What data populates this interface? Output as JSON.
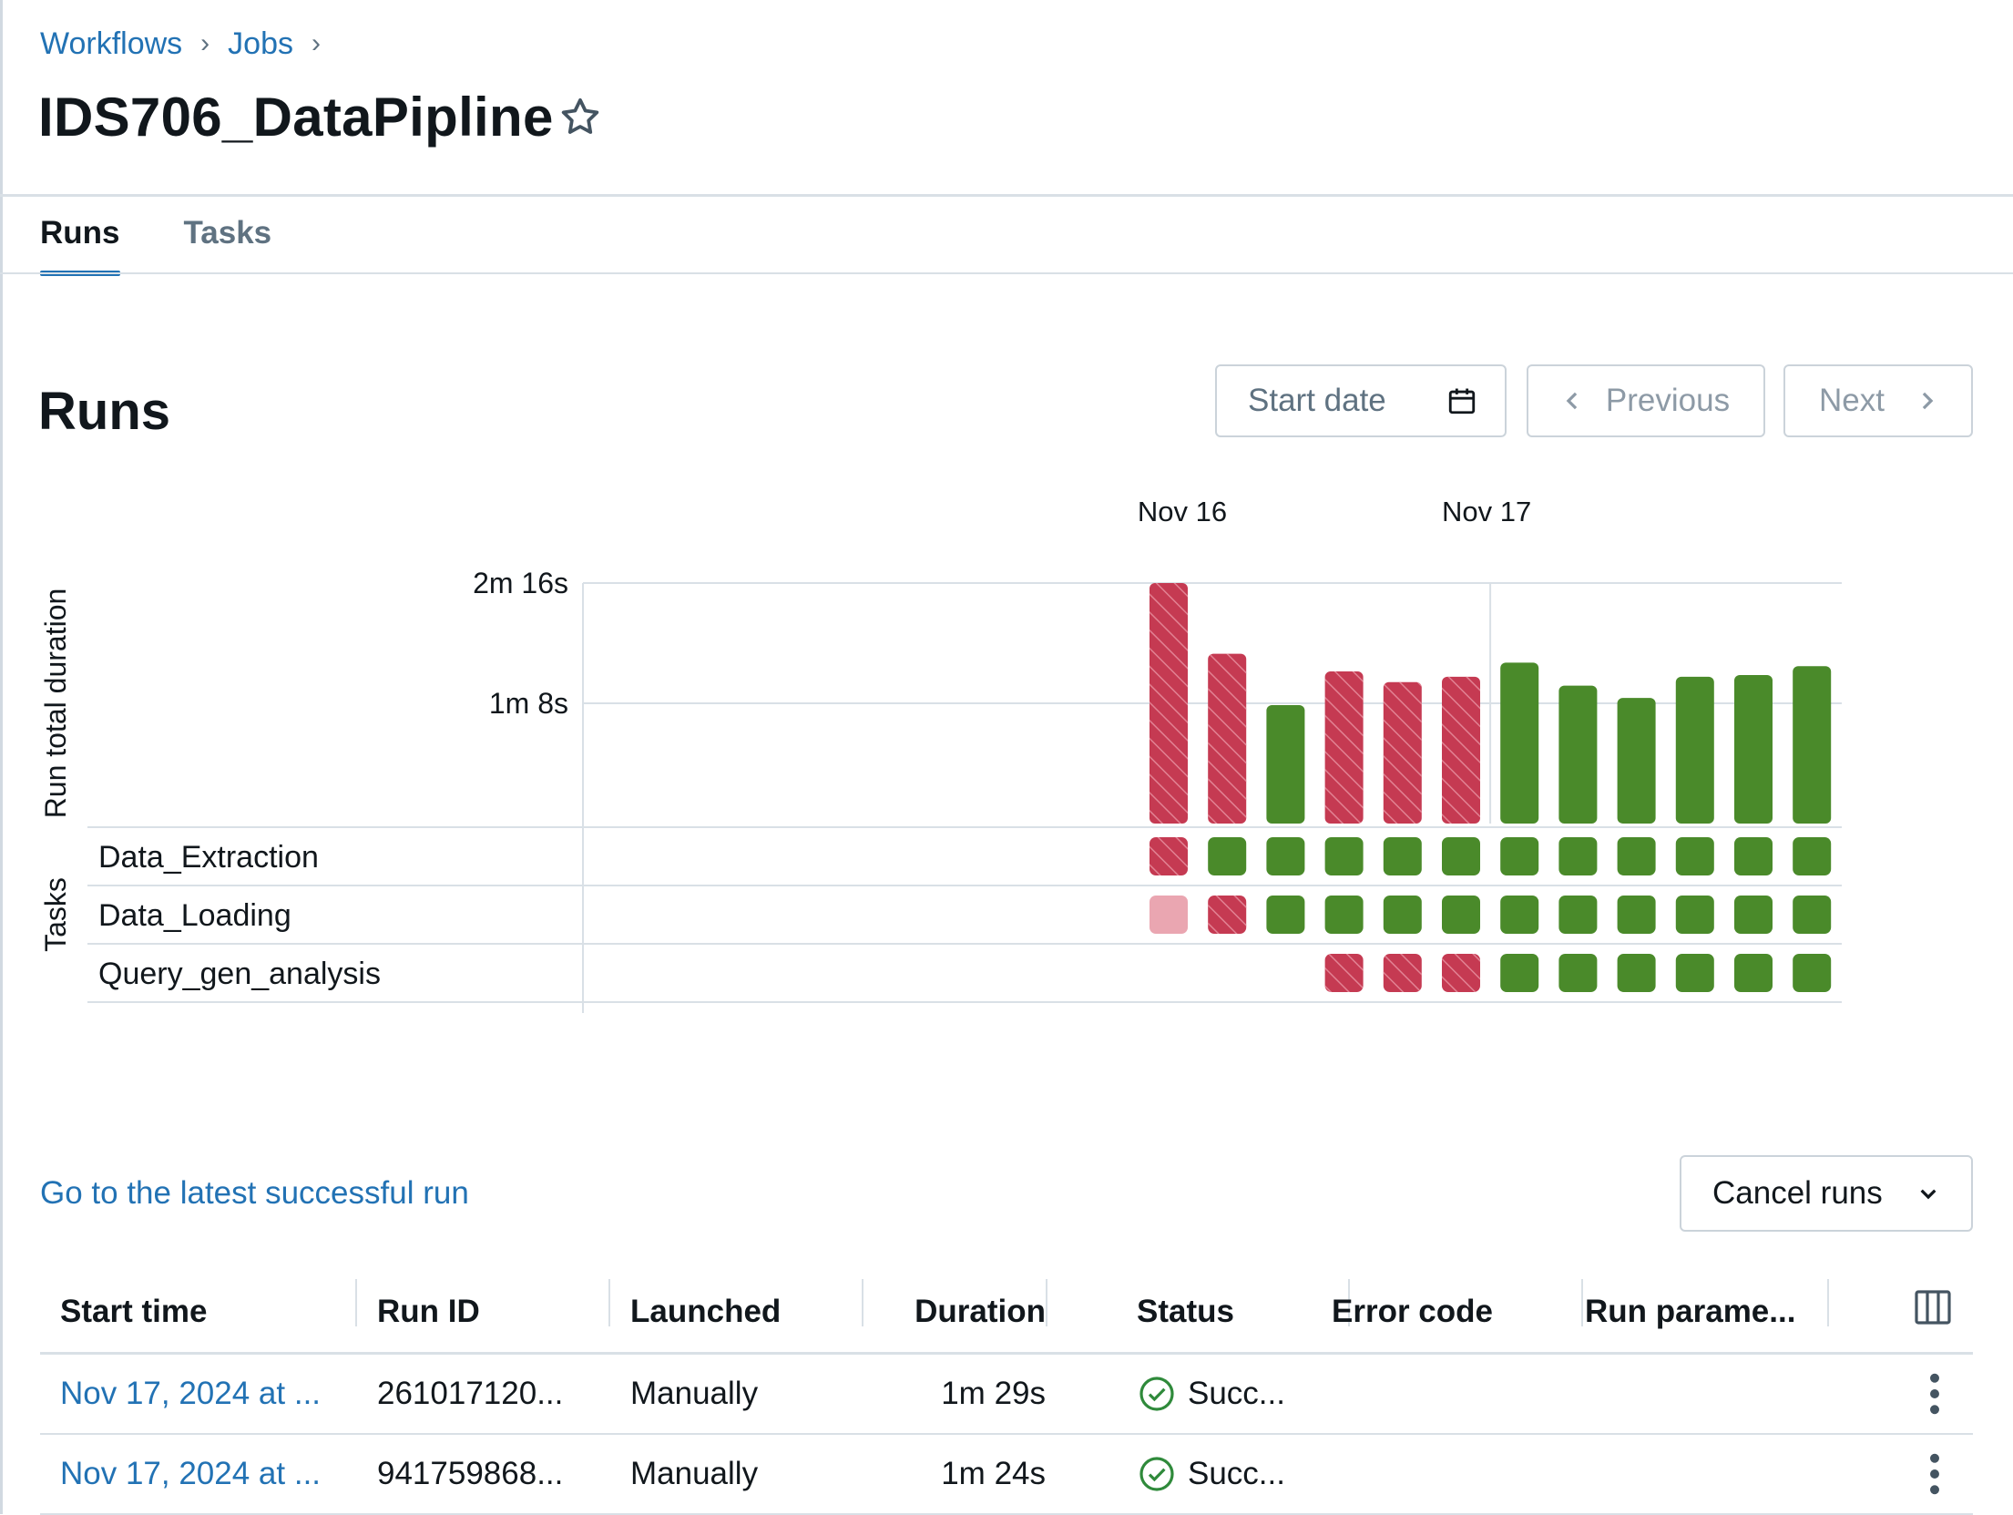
{
  "breadcrumb": {
    "items": [
      "Workflows",
      "Jobs"
    ],
    "separator": "›"
  },
  "job": {
    "title": "IDS706_DataPipline"
  },
  "tabs": [
    {
      "label": "Runs",
      "active": true
    },
    {
      "label": "Tasks",
      "active": false
    }
  ],
  "runs_section": {
    "title": "Runs",
    "start_date_label": "Start date",
    "previous_label": "Previous",
    "next_label": "Next"
  },
  "colors": {
    "success": "#4a8a2a",
    "failed": "#c53a52",
    "skipped": "#eaa6b1",
    "link": "#2272b4"
  },
  "chart_data": {
    "type": "bar",
    "ylabel": "Run total duration",
    "yticks": [
      {
        "seconds": 68,
        "label": "1m 8s"
      },
      {
        "seconds": 136,
        "label": "2m 16s"
      }
    ],
    "ylim": [
      0,
      136
    ],
    "date_marks": [
      {
        "label": "Nov 16",
        "before_run": 0
      },
      {
        "label": "Nov 17",
        "before_run": 6
      }
    ],
    "runs": [
      {
        "duration_s": 136,
        "status": "failed"
      },
      {
        "duration_s": 96,
        "status": "failed"
      },
      {
        "duration_s": 67,
        "status": "success"
      },
      {
        "duration_s": 86,
        "status": "failed"
      },
      {
        "duration_s": 80,
        "status": "failed"
      },
      {
        "duration_s": 83,
        "status": "failed"
      },
      {
        "duration_s": 91,
        "status": "success"
      },
      {
        "duration_s": 78,
        "status": "success"
      },
      {
        "duration_s": 71,
        "status": "success"
      },
      {
        "duration_s": 83,
        "status": "success"
      },
      {
        "duration_s": 84,
        "status": "success"
      },
      {
        "duration_s": 89,
        "status": "success"
      }
    ],
    "tasks_label": "Tasks",
    "tasks": [
      {
        "name": "Data_Extraction",
        "statuses": [
          "failed",
          "success",
          "success",
          "success",
          "success",
          "success",
          "success",
          "success",
          "success",
          "success",
          "success",
          "success"
        ]
      },
      {
        "name": "Data_Loading",
        "statuses": [
          "skipped",
          "failed",
          "success",
          "success",
          "success",
          "success",
          "success",
          "success",
          "success",
          "success",
          "success",
          "success"
        ]
      },
      {
        "name": "Query_gen_analysis",
        "statuses": [
          null,
          null,
          null,
          "failed",
          "failed",
          "failed",
          "success",
          "success",
          "success",
          "success",
          "success",
          "success"
        ]
      }
    ]
  },
  "latest_link": "Go to the latest successful run",
  "cancel_runs_label": "Cancel runs",
  "table": {
    "columns": [
      "Start time",
      "Run ID",
      "Launched",
      "Duration",
      "Status",
      "Error code",
      "Run parame..."
    ],
    "rows": [
      {
        "start_time": "Nov 17, 2024 at ...",
        "run_id": "261017120...",
        "launched": "Manually",
        "duration": "1m 29s",
        "status": "Succ...",
        "error_code": "",
        "run_params": ""
      },
      {
        "start_time": "Nov 17, 2024 at ...",
        "run_id": "941759868...",
        "launched": "Manually",
        "duration": "1m 24s",
        "status": "Succ...",
        "error_code": "",
        "run_params": ""
      }
    ]
  }
}
